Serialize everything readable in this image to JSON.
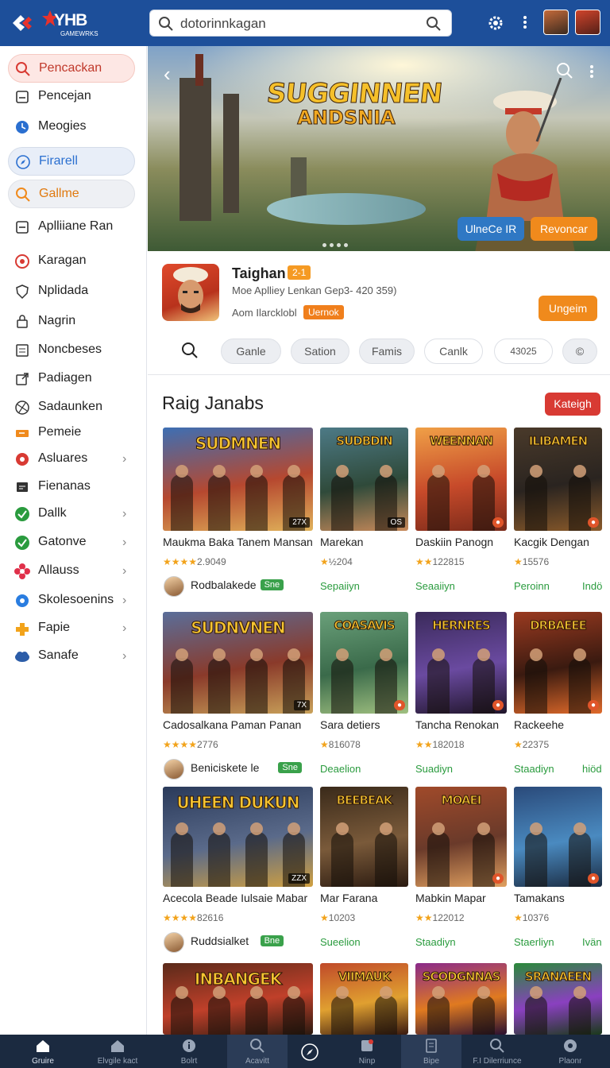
{
  "topbar": {
    "logo_text": "YHB",
    "logo_sub": "GAMEWRKS",
    "search_value": "dotorinnkagan"
  },
  "sidebar": {
    "items": [
      {
        "label": "Pencackan",
        "icon": "search-icon"
      },
      {
        "label": "Pencejan",
        "icon": "square-icon"
      },
      {
        "label": "Meogies",
        "icon": "clock-icon"
      },
      {
        "label": "Firarell",
        "icon": "compass-icon"
      },
      {
        "label": "Gallme",
        "icon": "search-icon"
      },
      {
        "label": "Aplliiane Ran",
        "icon": "minus-square-icon"
      },
      {
        "label": "Karagan",
        "icon": "gamepad-icon"
      },
      {
        "label": "Nplidada",
        "icon": "shield-icon"
      },
      {
        "label": "Nagrin",
        "icon": "lock-icon"
      },
      {
        "label": "Noncbeses",
        "icon": "list-icon"
      },
      {
        "label": "Padiagen",
        "icon": "share-icon"
      },
      {
        "label": "Sadaunken",
        "icon": "ball-icon"
      },
      {
        "label": "Pemeie",
        "icon": "ticket-icon"
      },
      {
        "label": "Asluares",
        "icon": "record-icon"
      },
      {
        "label": "Fienanas",
        "icon": "card-icon"
      },
      {
        "label": "Dallk",
        "icon": "check-icon"
      },
      {
        "label": "Gatonve",
        "icon": "check-icon"
      },
      {
        "label": "Allauss",
        "icon": "flower-icon"
      },
      {
        "label": "Skolesoenins",
        "icon": "gear-icon"
      },
      {
        "label": "Fapie",
        "icon": "puzzle-icon"
      },
      {
        "label": "Sanafe",
        "icon": "cloud-icon"
      }
    ]
  },
  "banner": {
    "title_line1": "SUGGINNEN",
    "title_line2": "ANDSNIA",
    "btn_blue": "UlneCe IR",
    "btn_orange": "Revoncar"
  },
  "app": {
    "name": "Taighan",
    "badge": "2-1",
    "desc": "Moe Aplliey Lenkan Gep3- 420 359)",
    "dev": "Aom Ilarcklobl",
    "dev_badge": "Uernok",
    "upgrade": "Ungeim",
    "chips": [
      "Ganle",
      "Sation",
      "Famis",
      "Canlk",
      "43025",
      "©"
    ]
  },
  "section": {
    "title": "Raig Janabs",
    "button": "Kateigh"
  },
  "rows": [
    {
      "cards": [
        {
          "art": "SUDMNEN",
          "corner": "27X",
          "title": "Maukma Baka Tanem Mansan",
          "rating": "2.9049",
          "stars": "★★★★"
        },
        {
          "art": "SUDBDIN",
          "corner": "OS",
          "title": "Marekan",
          "rating": "½204",
          "stars": "★"
        },
        {
          "art": "WEENNAN",
          "corner": "●",
          "title": "Daskiin Panogn",
          "rating": "122815",
          "stars": "★★"
        },
        {
          "art": "ILIBAMEN",
          "corner": "●",
          "title": "Kacgik Dengan",
          "rating": "15576",
          "stars": "★"
        }
      ],
      "dev": "Rodbalakede",
      "dev_tag": "Sne",
      "meta": [
        "Sepaiiyn",
        "Seaaiiyn",
        "Peroinn",
        "Indö"
      ]
    },
    {
      "cards": [
        {
          "art": "SUDNVNEN",
          "corner": "7X",
          "title": "Cadosalkana Paman Panan",
          "rating": "2776",
          "stars": "★★★★"
        },
        {
          "art": "COASAVIS",
          "corner": "●",
          "title": "Sara detiers",
          "rating": "816078",
          "stars": "★"
        },
        {
          "art": "HERNRES",
          "corner": "●",
          "title": "Tancha Renokan",
          "rating": "182018",
          "stars": "★★"
        },
        {
          "art": "DRBAEEE",
          "corner": "●",
          "title": "Rackeehe",
          "rating": "22375",
          "stars": "★"
        }
      ],
      "dev": "Beniciskete le",
      "dev_tag": "Sne",
      "meta": [
        "Deaelion",
        "Suadiyn",
        "Staadiyn",
        "hiöd"
      ]
    },
    {
      "cards": [
        {
          "art": "UHEEN DUKUN",
          "corner": "ZZX",
          "title": "Acecola Beade Iulsaie Mabar",
          "rating": "82616",
          "stars": "★★★★"
        },
        {
          "art": "BEEBEAK",
          "corner": "",
          "title": "Mar Farana",
          "rating": "10203",
          "stars": "★"
        },
        {
          "art": "MOAEI",
          "corner": "●",
          "title": "Mabkin Mapar",
          "rating": "122012",
          "stars": "★★"
        },
        {
          "art": "",
          "corner": "●",
          "title": "Tamakans",
          "rating": "10376",
          "stars": "★"
        }
      ],
      "dev": "Ruddsialket",
      "dev_tag": "Bne",
      "meta": [
        "Sueelion",
        "Staadiyn",
        "Staerliyn",
        "Ivän"
      ]
    },
    {
      "cards": [
        {
          "art": "INBANGEK",
          "corner": "",
          "title": "",
          "rating": "",
          "stars": ""
        },
        {
          "art": "VIIMAUK",
          "corner": "",
          "title": "",
          "rating": "",
          "stars": ""
        },
        {
          "art": "SCODGNNAS",
          "corner": "",
          "title": "",
          "rating": "",
          "stars": ""
        },
        {
          "art": "SRANAEEN",
          "corner": "",
          "title": "",
          "rating": "",
          "stars": ""
        }
      ]
    }
  ],
  "bottomnav": [
    {
      "label": "Gruire",
      "icon": "home-icon"
    },
    {
      "label": "Elvgile kact",
      "icon": "home-icon"
    },
    {
      "label": "Bolrt",
      "icon": "info-icon"
    },
    {
      "label": "Acavitt",
      "icon": "search-icon"
    },
    {
      "label": "",
      "icon": "compass-icon"
    },
    {
      "label": "Ninp",
      "icon": "game-icon"
    },
    {
      "label": "Bipe",
      "icon": "tablet-icon"
    },
    {
      "label": "F.I Dilerriunce",
      "icon": "search-icon"
    },
    {
      "label": "Plaonr",
      "icon": "joystick-icon"
    }
  ],
  "colors": {
    "topbar": "#1d4f9a",
    "accent_orange": "#f08a1c",
    "accent_red": "#d83a33",
    "accent_green": "#2a9b3e",
    "nav_bg": "#1b2a40"
  }
}
